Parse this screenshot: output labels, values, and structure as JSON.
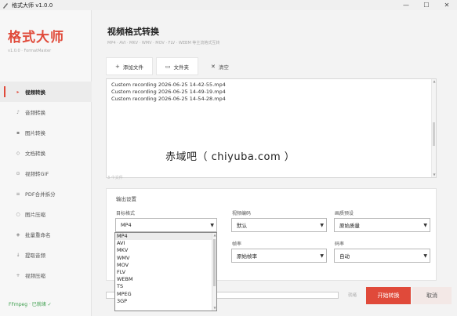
{
  "window": {
    "title": "格式大师 v1.0.0",
    "minimize_glyph": "—",
    "maximize_glyph": "☐",
    "close_glyph": "✕"
  },
  "sidebar": {
    "brand": "格式大师",
    "version": "v1.0.0 · FormatMaster",
    "items": [
      {
        "icon": "▸",
        "icon_name": "play-icon",
        "label": "视频转换",
        "active": true
      },
      {
        "icon": "♪",
        "icon_name": "music-icon",
        "label": "音频转换",
        "active": false
      },
      {
        "icon": "▪",
        "icon_name": "image-icon",
        "label": "图片转换",
        "active": false
      },
      {
        "icon": "◇",
        "icon_name": "document-icon",
        "label": "文档转换",
        "active": false
      },
      {
        "icon": "⊙",
        "icon_name": "gif-icon",
        "label": "视频转GIF",
        "active": false
      },
      {
        "icon": "≡",
        "icon_name": "pdf-icon",
        "label": "PDF合并拆分",
        "active": false
      },
      {
        "icon": "○",
        "icon_name": "compress-image-icon",
        "label": "图片压缩",
        "active": false
      },
      {
        "icon": "◈",
        "icon_name": "rename-icon",
        "label": "批量重命名",
        "active": false
      },
      {
        "icon": "↓",
        "icon_name": "extract-audio-icon",
        "label": "提取音频",
        "active": false
      },
      {
        "icon": "+",
        "icon_name": "compress-video-icon",
        "label": "视频压缩",
        "active": false
      }
    ],
    "ffmpeg_status": "FFmpeg · 已就绪 ✓"
  },
  "main": {
    "title": "视频格式转换",
    "subtitle": "MP4 · AVI · MKV · WMV · MOV · FLV · WEBM 等主流格式互转",
    "toolbar": {
      "add_file_icon": "+",
      "add_file": "添加文件",
      "folder_icon": "▭",
      "add_folder": "文件夹",
      "clear_icon": "✕",
      "clear": "清空"
    },
    "files": [
      "Custom recording 2026-06-25 14-42-55.mp4",
      "Custom recording 2026-06-25 14-49-19.mp4",
      "Custom recording 2026-06-25 14-54-28.mp4"
    ],
    "file_count": "3 个文件",
    "watermark": "赤域吧（ chiyuba.com ）",
    "settings": {
      "title": "输出设置",
      "target_format_label": "目标格式",
      "target_format_value": "MP4",
      "video_codec_label": "视频编码",
      "video_codec_value": "默认",
      "quality_label": "画质预设",
      "quality_value": "原始质量",
      "framerate_label": "帧率",
      "framerate_value": "原始帧率",
      "bitrate_label": "码率",
      "bitrate_value": "自动"
    },
    "format_options": [
      "MP4",
      "AVI",
      "MKV",
      "WMV",
      "MOV",
      "FLV",
      "WEBM",
      "TS",
      "MPEG",
      "3GP"
    ],
    "progress_percent": 0,
    "status": "就绪",
    "start_button": "开始转换",
    "cancel_button": "取消"
  },
  "colors": {
    "accent": "#e04a3a",
    "ffmpeg_ok": "#3a9d4a"
  }
}
